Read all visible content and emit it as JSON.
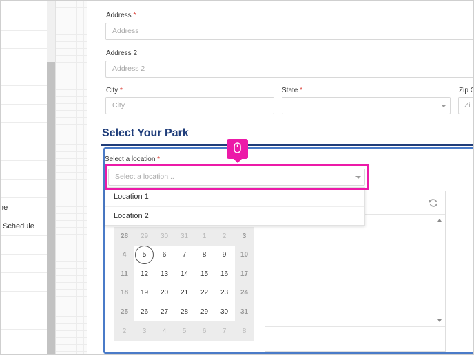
{
  "sidebar": {
    "items": [
      {
        "label": "ne"
      },
      {
        "label": "Schedule"
      }
    ]
  },
  "form": {
    "address": {
      "label": "Address",
      "required_mark": "*",
      "placeholder": "Address"
    },
    "address2": {
      "label": "Address 2",
      "placeholder": "Address 2"
    },
    "city": {
      "label": "City",
      "required_mark": "*",
      "placeholder": "City"
    },
    "state": {
      "label": "State",
      "required_mark": "*",
      "value": ""
    },
    "zip": {
      "label": "Zip C",
      "placeholder": "Zi"
    }
  },
  "park": {
    "title": "Select Your Park",
    "location_label": "Select a location",
    "location_required": "*",
    "location_placeholder": "Select a location...",
    "options": [
      "Location 1",
      "Location 2"
    ]
  },
  "calendar": {
    "weeks": [
      [
        "28",
        "29",
        "30",
        "31",
        "1",
        "2",
        "3"
      ],
      [
        "4",
        "5",
        "6",
        "7",
        "8",
        "9",
        "10"
      ],
      [
        "11",
        "12",
        "13",
        "14",
        "15",
        "16",
        "17"
      ],
      [
        "18",
        "19",
        "20",
        "21",
        "22",
        "23",
        "24"
      ],
      [
        "25",
        "26",
        "27",
        "28",
        "29",
        "30",
        "31"
      ],
      [
        "2",
        "3",
        "4",
        "5",
        "6",
        "7",
        "8"
      ]
    ],
    "selected": "5"
  },
  "icons": {
    "tooltip": "mouse-icon",
    "refresh": "refresh-icon"
  },
  "colors": {
    "accent": "#ec1aa8",
    "title": "#1f3d7a",
    "box_border": "#4a7bc8",
    "required": "#d9342b"
  }
}
